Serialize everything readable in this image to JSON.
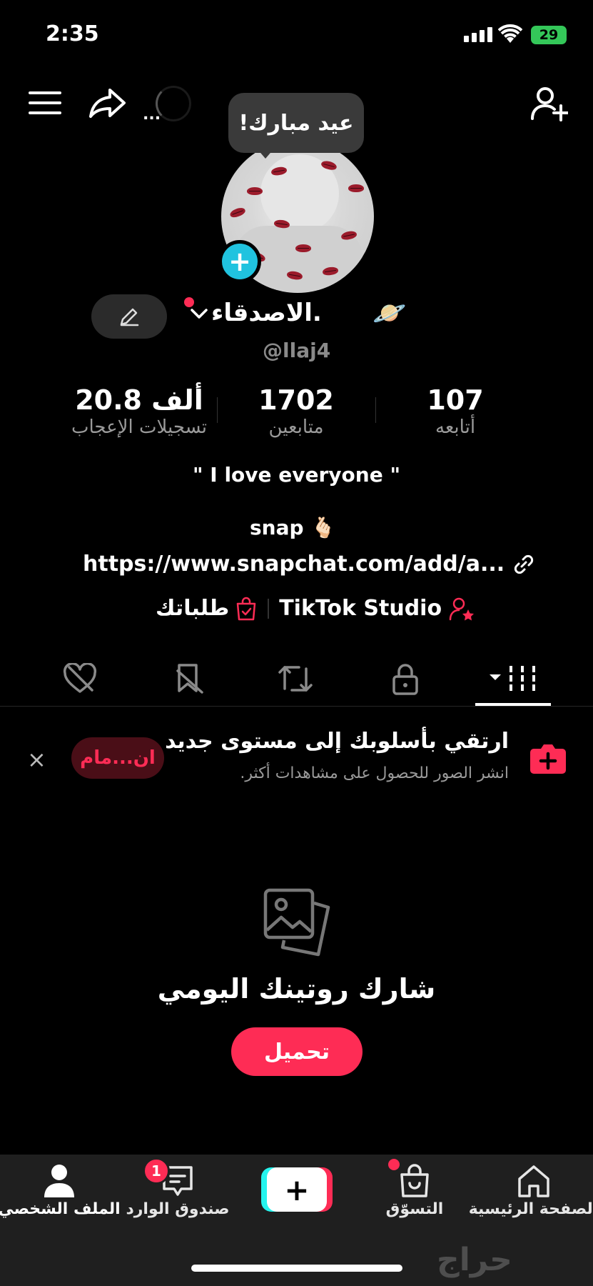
{
  "status_bar": {
    "time": "2:35",
    "battery": "29"
  },
  "top_nav": {
    "more_label": "..."
  },
  "bubble": {
    "text": "عيد مبارك!"
  },
  "profile": {
    "display_name": ".الاصدقاء",
    "planet_emoji": "🪐",
    "username": "@llaj4"
  },
  "stats": [
    {
      "value": "20.8 ألف",
      "label": "تسجيلات الإعجاب"
    },
    {
      "value": "1702",
      "label": "متابعين"
    },
    {
      "value": "107",
      "label": "أتابعه"
    }
  ],
  "bio": {
    "text": "\" I love everyone \"",
    "snap": "snap",
    "snap_emoji": "🫰🏻"
  },
  "link": {
    "text": "https://www.snapchat.com/add/a..."
  },
  "studio": {
    "label": "TikTok Studio",
    "orders_label": "طلباتك"
  },
  "promo": {
    "title": "ارتقي بأسلوبك إلى مستوى جديد",
    "subtitle": "انشر الصور للحصول على مشاهدات أكثر.",
    "join_label": "ان...مام",
    "close": "×"
  },
  "empty_state": {
    "title": "شارك روتينك اليومي",
    "button": "تحميل"
  },
  "bottom_nav": {
    "home": "الصفحة الرئيسية",
    "shop": "التسوّق",
    "inbox": "صندوق الوارد",
    "inbox_badge": "1",
    "profile": "الملف الشخصي"
  },
  "watermark": "حراج",
  "colors": {
    "accent": "#fe2c55",
    "badge_cyan": "#20c3df",
    "battery": "#34c759"
  }
}
